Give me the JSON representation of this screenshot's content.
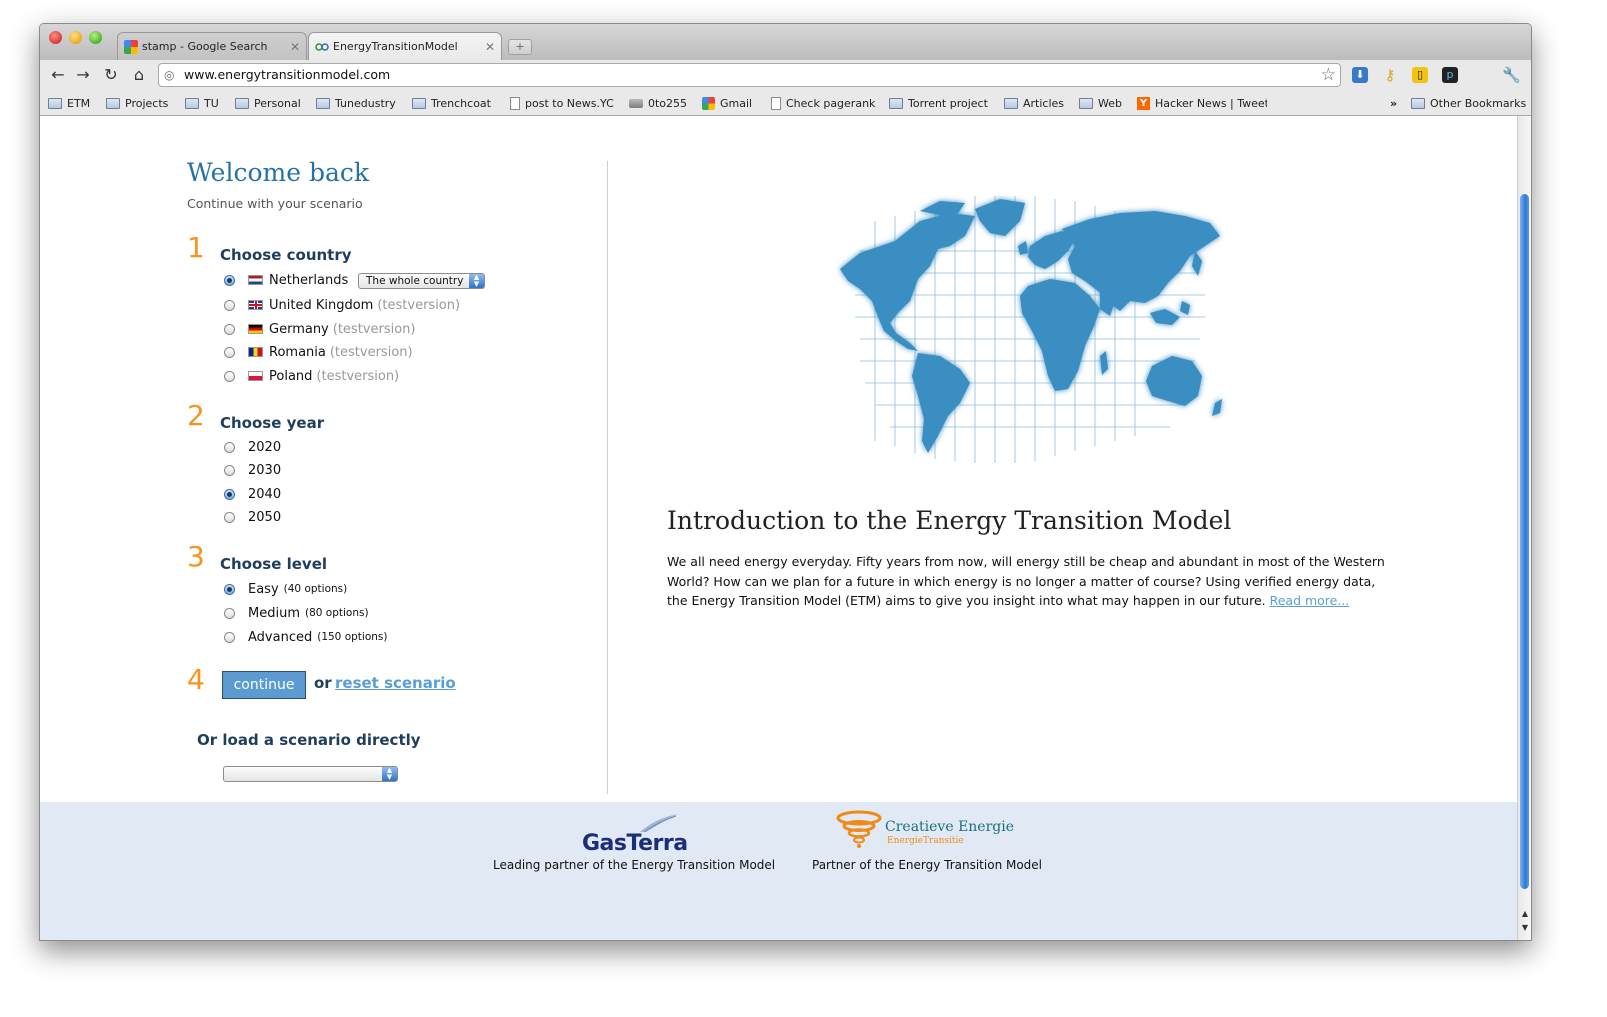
{
  "tabs": [
    {
      "title": "stamp - Google Search"
    },
    {
      "title": "EnergyTransitionModel"
    }
  ],
  "toolbar": {
    "url": "www.energytransitionmodel.com"
  },
  "bookmarks": [
    "ETM",
    "Projects",
    "TU",
    "Personal",
    "Tunedustry",
    "Trenchcoat",
    "post to News.YC",
    "0to255",
    "Gmail",
    "Check pagerank",
    "Torrent project",
    "Articles",
    "Web",
    "Hacker News | Tweet",
    "»",
    "Other Bookmarks"
  ],
  "page": {
    "welcome_title": "Welcome back",
    "welcome_subtitle": "Continue with your scenario",
    "steps": {
      "country": {
        "number": "1",
        "title": "Choose country",
        "region_select": "The whole country",
        "options": [
          {
            "name": "Netherlands",
            "note": "",
            "selected": true
          },
          {
            "name": "United Kingdom",
            "note": "(testversion)",
            "selected": false
          },
          {
            "name": "Germany",
            "note": "(testversion)",
            "selected": false
          },
          {
            "name": "Romania",
            "note": "(testversion)",
            "selected": false
          },
          {
            "name": "Poland",
            "note": "(testversion)",
            "selected": false
          }
        ]
      },
      "year": {
        "number": "2",
        "title": "Choose year",
        "options": [
          "2020",
          "2030",
          "2040",
          "2050"
        ],
        "selected": "2040"
      },
      "level": {
        "number": "3",
        "title": "Choose level",
        "options": [
          {
            "name": "Easy",
            "note": "(40 options)",
            "selected": true
          },
          {
            "name": "Medium",
            "note": "(80 options)",
            "selected": false
          },
          {
            "name": "Advanced",
            "note": "(150 options)",
            "selected": false
          }
        ]
      },
      "submit": {
        "number": "4",
        "continue_label": "continue",
        "or_label": "or",
        "reset_label": "reset scenario"
      }
    },
    "load_title": "Or load a scenario directly",
    "load_select_value": "",
    "intro": {
      "title": "Introduction to the Energy Transition Model",
      "text": "We all need energy everyday. Fifty years from now, will energy still be cheap and abundant in most of the Western World? How can we plan for a future in which energy is no longer a matter of course? Using verified energy data, the Energy Transition Model (ETM) aims to give you insight into what may happen in our future.",
      "read_more": "Read more..."
    }
  },
  "footer": {
    "gasterra_logo": "GasTerra",
    "gasterra_caption": "Leading partner of the Energy Transition Model",
    "ce_name": "Creatieve Energie",
    "ce_sub": "EnergieTransitie",
    "ce_caption": "Partner of the Energy Transition Model"
  },
  "colors": {
    "accent_blue": "#2573a6",
    "step_orange": "#f7931e",
    "link_blue": "#5a9ed6",
    "footer_bg": "#e1e9f4",
    "map_blue": "#3b8ec1"
  }
}
